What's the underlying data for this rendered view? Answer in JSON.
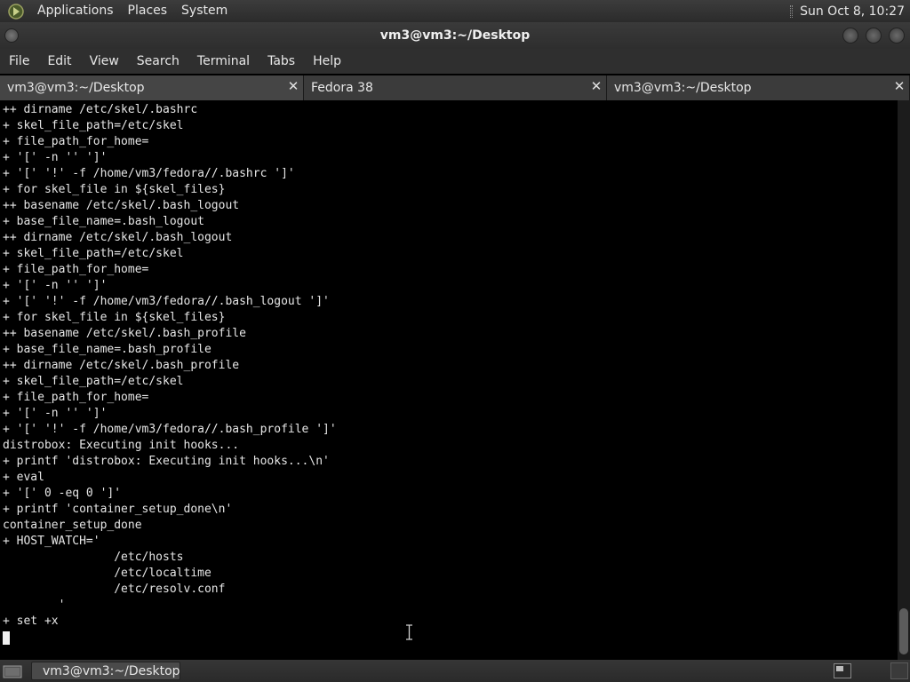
{
  "top_panel": {
    "menus": [
      "Applications",
      "Places",
      "System"
    ],
    "clock": "Sun Oct  8, 10:27"
  },
  "window": {
    "title": "vm3@vm3:~/Desktop"
  },
  "menubar": [
    "File",
    "Edit",
    "View",
    "Search",
    "Terminal",
    "Tabs",
    "Help"
  ],
  "tabs": [
    {
      "label": "vm3@vm3:~/Desktop",
      "active": true
    },
    {
      "label": "Fedora 38",
      "active": false
    },
    {
      "label": "vm3@vm3:~/Desktop",
      "active": false
    }
  ],
  "terminal": {
    "lines": [
      "++ dirname /etc/skel/.bashrc",
      "+ skel_file_path=/etc/skel",
      "+ file_path_for_home=",
      "+ '[' -n '' ']'",
      "+ '[' '!' -f /home/vm3/fedora//.bashrc ']'",
      "+ for skel_file in ${skel_files}",
      "++ basename /etc/skel/.bash_logout",
      "+ base_file_name=.bash_logout",
      "++ dirname /etc/skel/.bash_logout",
      "+ skel_file_path=/etc/skel",
      "+ file_path_for_home=",
      "+ '[' -n '' ']'",
      "+ '[' '!' -f /home/vm3/fedora//.bash_logout ']'",
      "+ for skel_file in ${skel_files}",
      "++ basename /etc/skel/.bash_profile",
      "+ base_file_name=.bash_profile",
      "++ dirname /etc/skel/.bash_profile",
      "+ skel_file_path=/etc/skel",
      "+ file_path_for_home=",
      "+ '[' -n '' ']'",
      "+ '[' '!' -f /home/vm3/fedora//.bash_profile ']'",
      "distrobox: Executing init hooks...",
      "+ printf 'distrobox: Executing init hooks...\\n'",
      "+ eval",
      "+ '[' 0 -eq 0 ']'",
      "+ printf 'container_setup_done\\n'",
      "container_setup_done",
      "+ HOST_WATCH='",
      "                /etc/hosts",
      "                /etc/localtime",
      "                /etc/resolv.conf",
      "        '",
      "+ set +x"
    ]
  },
  "taskbar": {
    "window_button": "vm3@vm3:~/Desktop"
  },
  "colors": {
    "terminal_bg": "#000000",
    "terminal_fg": "#e6e6e6",
    "panel_bg": "#2f2f2f"
  }
}
